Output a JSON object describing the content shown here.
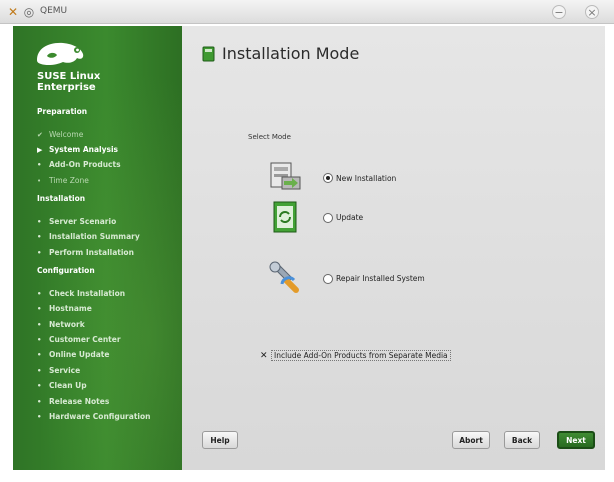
{
  "window": {
    "title": "QEMU",
    "app_icon": "qemu-icon",
    "min_icon": "minimize-icon",
    "close_icon": "close-icon"
  },
  "sidebar": {
    "brand_line1": "SUSE Linux",
    "brand_line2": "Enterprise",
    "logo": "suse-chameleon-logo",
    "sections": [
      {
        "title": "Preparation",
        "steps": [
          {
            "label": "Welcome",
            "state": "done"
          },
          {
            "label": "System Analysis",
            "state": "current"
          },
          {
            "label": "Add-On Products",
            "state": "pending"
          },
          {
            "label": "Time Zone",
            "state": "pending"
          }
        ]
      },
      {
        "title": "Installation",
        "steps": [
          {
            "label": "Server Scenario",
            "state": "todo"
          },
          {
            "label": "Installation Summary",
            "state": "todo"
          },
          {
            "label": "Perform Installation",
            "state": "todo"
          }
        ]
      },
      {
        "title": "Configuration",
        "steps": [
          {
            "label": "Check Installation",
            "state": "todo"
          },
          {
            "label": "Hostname",
            "state": "todo"
          },
          {
            "label": "Network",
            "state": "todo"
          },
          {
            "label": "Customer Center",
            "state": "todo"
          },
          {
            "label": "Online Update",
            "state": "todo"
          },
          {
            "label": "Service",
            "state": "todo"
          },
          {
            "label": "Clean Up",
            "state": "todo"
          },
          {
            "label": "Release Notes",
            "state": "todo"
          },
          {
            "label": "Hardware Configuration",
            "state": "todo"
          }
        ]
      }
    ]
  },
  "main": {
    "title": "Installation Mode",
    "title_icon": "installation-mode-icon",
    "frame_label": "Select Mode",
    "options": [
      {
        "label": "New Installation",
        "selected": true,
        "icon": "new-installation-icon"
      },
      {
        "label": "Update",
        "selected": false,
        "icon": "update-icon"
      },
      {
        "label": "Repair Installed System",
        "selected": false,
        "icon": "repair-icon"
      }
    ],
    "addon_checkbox": {
      "label": "Include Add-On Products from Separate Media",
      "checked": true
    }
  },
  "buttons": {
    "help": "Help",
    "abort": "Abort",
    "back": "Back",
    "next": "Next"
  },
  "colors": {
    "sidebar_green": "#3b8a2e",
    "next_button": "#2f7a27"
  }
}
